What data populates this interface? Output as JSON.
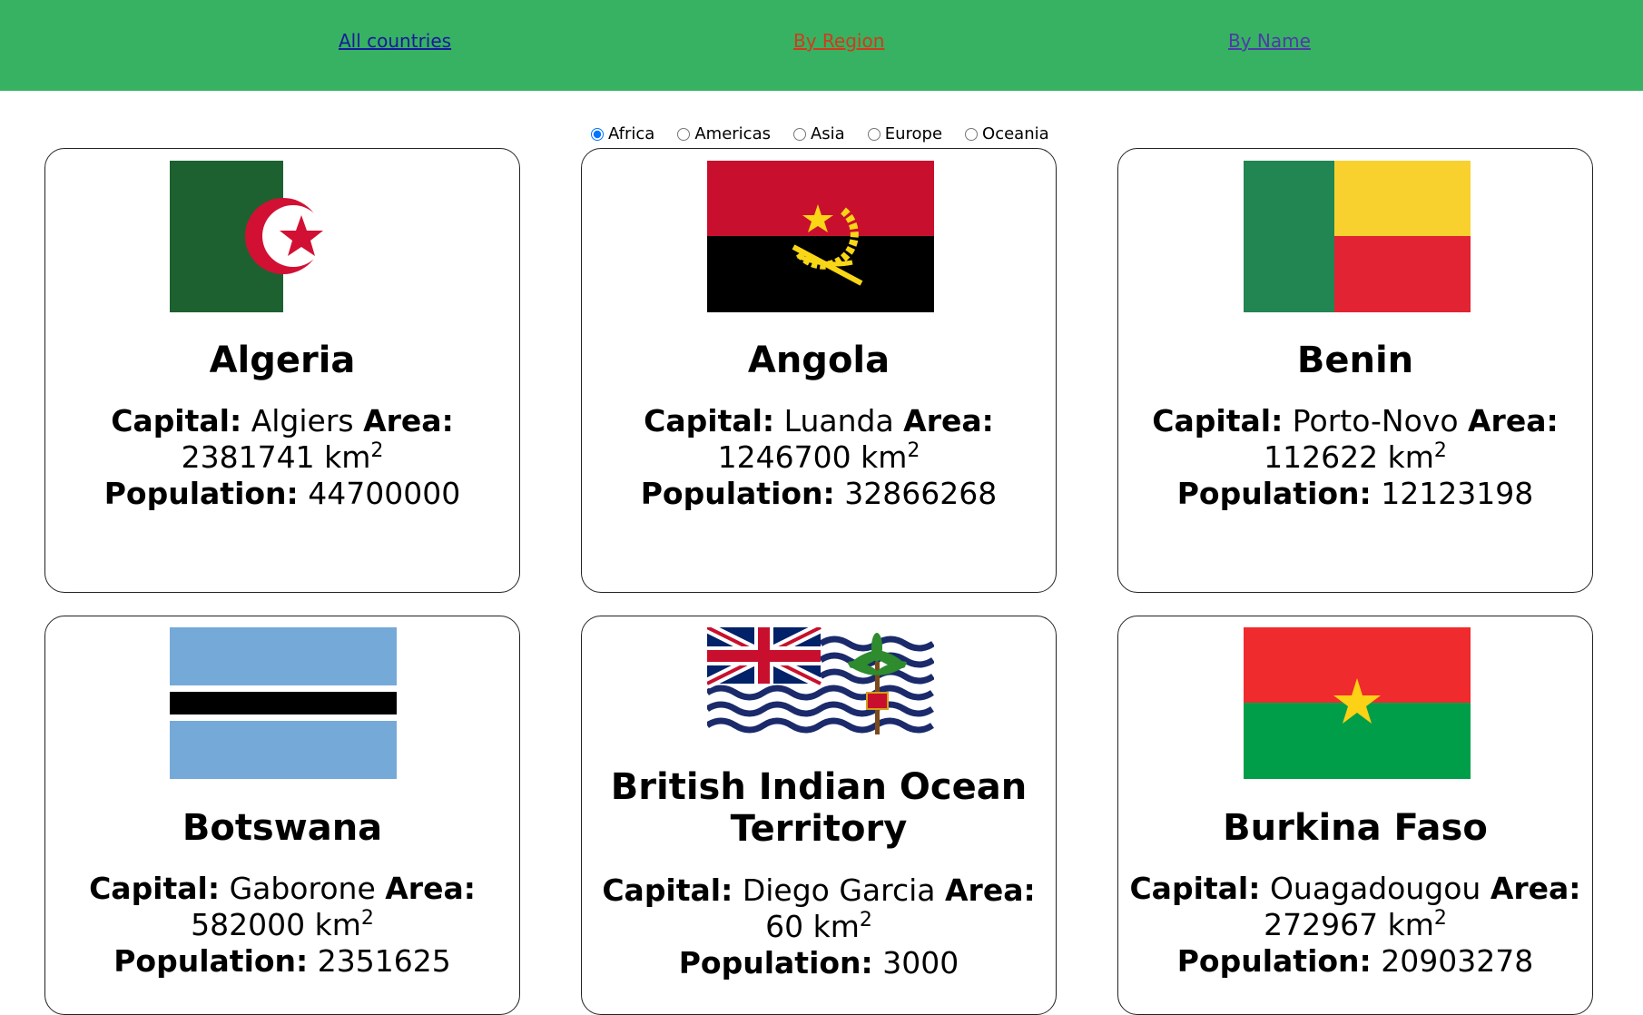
{
  "nav": {
    "all_countries": "All countries",
    "by_region": "By Region",
    "by_name": "By Name"
  },
  "regions": {
    "options": [
      "Africa",
      "Americas",
      "Asia",
      "Europe",
      "Oceania"
    ],
    "selected": "Africa"
  },
  "labels": {
    "capital": "Capital:",
    "area": "Area:",
    "population": "Population:",
    "unit": "km",
    "unit_sup": "2"
  },
  "countries": [
    {
      "name": "Algeria",
      "capital": "Algiers",
      "area": "2381741",
      "population": "44700000"
    },
    {
      "name": "Angola",
      "capital": "Luanda",
      "area": "1246700",
      "population": "32866268"
    },
    {
      "name": "Benin",
      "capital": "Porto-Novo",
      "area": "112622",
      "population": "12123198"
    },
    {
      "name": "Botswana",
      "capital": "Gaborone",
      "area": "582000",
      "population": "2351625"
    },
    {
      "name": "British Indian Ocean Territory",
      "capital": "Diego Garcia",
      "area": "60",
      "population": "3000"
    },
    {
      "name": "Burkina Faso",
      "capital": "Ouagadougou",
      "area": "272967",
      "population": "20903278"
    }
  ],
  "colors": {
    "nav_bg": "#36b262",
    "link_all": "#1a1a9a",
    "link_region": "#d23a1c",
    "link_name": "#4f3aa8"
  }
}
